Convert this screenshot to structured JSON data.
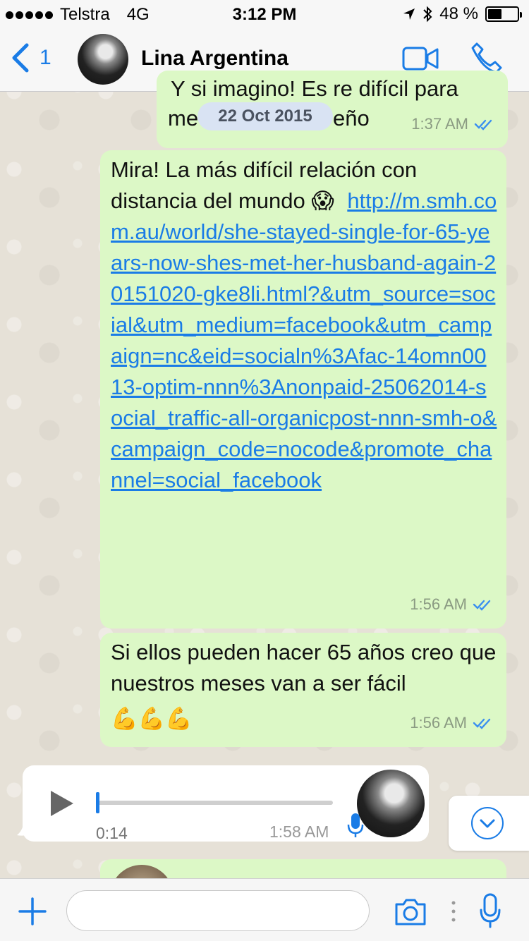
{
  "status_bar": {
    "carrier": "Telstra",
    "network": "4G",
    "time": "3:12 PM",
    "battery": "48 %",
    "battery_level": 0.48
  },
  "header": {
    "back_count": "1",
    "contact_name": "Lina Argentina",
    "icons": [
      "back-chevron-icon",
      "video-call-icon",
      "phone-icon"
    ]
  },
  "date_pill": "22 Oct 2015",
  "messages": [
    {
      "partial_text": "Y si imagino! Es re difícil para",
      "partial_text2": "me",
      "partial_text3": "eño",
      "time": "1:37 AM",
      "status": "read"
    },
    {
      "text": "Mira! La más difícil relación con distancia del mundo",
      "emoji": "😱",
      "link": "http://m.smh.com.au/world/she-stayed-single-for-65-years-now-shes-met-her-husband-again-20151020-gke8li.html?&utm_source=social&utm_medium=facebook&utm_campaign=nc&eid=socialn%3Afac-14omn0013-optim-nnn%3Anonpaid-25062014-social_traffic-all-organicpost-nnn-smh-o&campaign_code=nocode&promote_channel=social_facebook",
      "time": "1:56 AM",
      "status": "read"
    },
    {
      "text": "Si ellos pueden hacer 65 años creo que nuestros meses van a ser fácil",
      "emoji": "💪💪💪",
      "time": "1:56 AM",
      "status": "read"
    }
  ],
  "voice_message": {
    "duration": "0:14",
    "time": "1:58 AM",
    "progress": 0
  },
  "input": {
    "placeholder": ""
  },
  "colors": {
    "accent": "#1a7ce6",
    "outgoing_bubble": "#dcf8c6",
    "incoming_bubble": "#ffffff",
    "wallpaper": "#e6e1d7"
  }
}
